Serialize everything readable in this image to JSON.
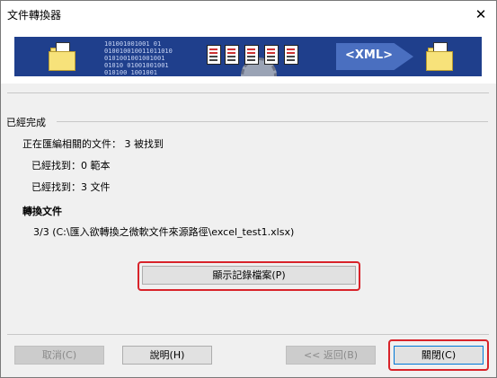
{
  "window": {
    "title": "文件轉換器",
    "close_glyph": "✕"
  },
  "banner": {
    "binary_text": "101001001001 01\n010010010011011010\n0101001001001001\n01010 01001001001\n010100 1001001",
    "xml_label": "<XML>"
  },
  "status": {
    "heading": "已經完成",
    "searching": "正在匯編相關的文件：  3  被找到",
    "found_templates": "已經找到：0 範本",
    "found_documents": "已經找到：3 文件"
  },
  "convert": {
    "heading": "轉換文件",
    "progress_line": "3/3  (C:\\匯入欲轉換之微軟文件來源路徑\\excel_test1.xlsx)"
  },
  "buttons": {
    "show_log": "顯示記錄檔案(P)",
    "cancel": "取消(C)",
    "help": "說明(H)",
    "back": "<< 返回(B)",
    "close": "關閉(C)"
  },
  "colors": {
    "banner_bg": "#1f3f8c",
    "highlight": "#d8232a",
    "default_border": "#0078d7"
  }
}
